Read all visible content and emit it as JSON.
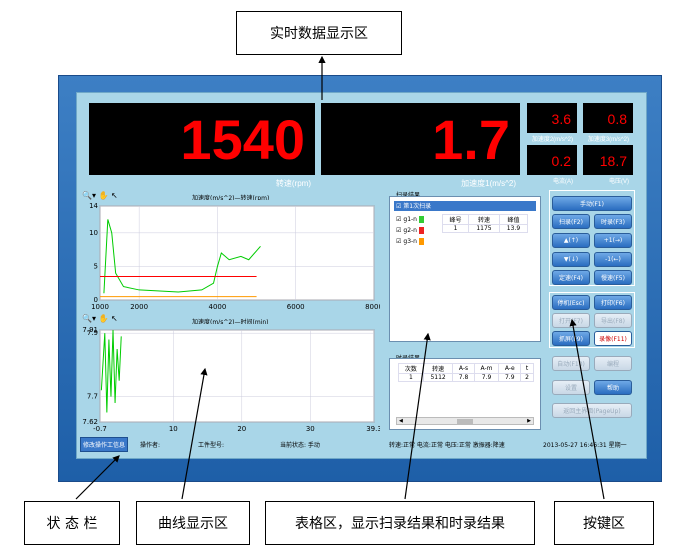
{
  "callouts": {
    "realtime": "实时数据显示区",
    "status": "状 态 栏",
    "curve": "曲线显示区",
    "table": "表格区，显示扫录结果和时录结果",
    "keys": "按键区"
  },
  "readouts": {
    "speed": {
      "value": "1540",
      "label": "转速(rpm)"
    },
    "accel1": {
      "value": "1.7",
      "label": "加速度1(m/s^2)"
    },
    "accel2": {
      "value": "3.6",
      "label": "加速度2(m/s^2)"
    },
    "accel3": {
      "value": "0.8",
      "label": "加速度3(m/s^2)"
    },
    "current": {
      "value": "0.2",
      "label": "电流(A)"
    },
    "voltage": {
      "value": "18.7",
      "label": "电压(V)"
    }
  },
  "chart1": {
    "title": "加速度(m/s^2)—转速(rpm)",
    "yticks": [
      "14",
      "10",
      "5",
      "0"
    ],
    "xticks": [
      "1000",
      "2000",
      "4000",
      "6000",
      "8000"
    ]
  },
  "chart2": {
    "title": "加速度(m/s^2)—时间(min)",
    "yticks": [
      "7.91",
      "7.9",
      "7.7",
      "7.62"
    ],
    "xticks": [
      "-0.7",
      "10",
      "20",
      "30",
      "39.3"
    ]
  },
  "chart_data": [
    {
      "type": "line",
      "title": "加速度(m/s^2)—转速(rpm)",
      "xlim": [
        1000,
        8000
      ],
      "ylim": [
        0,
        14
      ],
      "series": [
        {
          "color": "#00cc00",
          "x": [
            1100,
            1200,
            1300,
            1400,
            1600,
            2000,
            3000,
            3600,
            3900,
            4000,
            4100,
            4300,
            4600,
            4800,
            5100
          ],
          "y": [
            1,
            12,
            10,
            4,
            2,
            1.5,
            1.2,
            1.5,
            2.5,
            5,
            7,
            6,
            6.5,
            6,
            8
          ]
        },
        {
          "color": "#ff0000",
          "x": [
            1000,
            5000
          ],
          "y": [
            3.5,
            3.5
          ]
        },
        {
          "color": "#ff9900",
          "x": [
            1000,
            5000
          ],
          "y": [
            0.5,
            0.5
          ]
        }
      ]
    },
    {
      "type": "line",
      "title": "加速度(m/s^2)—时间(min)",
      "xlim": [
        -0.7,
        39.3
      ],
      "ylim": [
        7.62,
        7.91
      ],
      "series": [
        {
          "color": "#00cc00",
          "x": [
            -0.5,
            0,
            0.3,
            0.6,
            0.9,
            1.2,
            1.5,
            1.8,
            2.1,
            2.4
          ],
          "y": [
            7.72,
            7.9,
            7.65,
            7.88,
            7.7,
            7.91,
            7.68,
            7.85,
            7.75,
            7.89
          ]
        }
      ]
    }
  ],
  "scan": {
    "title": "扫录结果",
    "root": "第1次扫录",
    "channels": [
      {
        "label": "g1-n",
        "color": "#33cc33"
      },
      {
        "label": "g2-n",
        "color": "#ee2222"
      },
      {
        "label": "g3-n",
        "color": "#ff9900"
      }
    ],
    "headers": [
      "峰号",
      "转速",
      "峰值"
    ],
    "rows": [
      [
        "1",
        "1175",
        "13.9"
      ]
    ]
  },
  "timerec": {
    "title": "时录结果",
    "headers": [
      "次数",
      "转速",
      "A-s",
      "A-m",
      "A-e",
      "t"
    ],
    "rows": [
      [
        "1",
        "5112",
        "7.8",
        "7.9",
        "7.9",
        "2"
      ]
    ]
  },
  "buttons": {
    "manual": "手动(F1)",
    "scanrec": "扫录(F2)",
    "timerec": "时录(F3)",
    "up": "▲(↑)",
    "plus": "+1(→)",
    "down": "▼(↓)",
    "minus": "-1(←)",
    "fixspeed": "定速(F4)",
    "slow": "慢速(F5)",
    "stop": "停机(Esc)",
    "print": "打印(F6)",
    "open": "打开(F7)",
    "export": "导出(F8)",
    "capture": "抓屏(F9)",
    "record": "录像(F11)",
    "auto": "自动(F10)",
    "program": "编程",
    "settings": "设置",
    "help": "帮助",
    "back": "返回主界面(PageUp)"
  },
  "status": {
    "edit": "修改操作工信息",
    "operator": "操作者:",
    "part": "工件型号:",
    "state": "当前状态: 手动",
    "health": "转速:正常  电流:正常  电压:正常  激振器:降速",
    "time": "2013-05-27 16:46:31 星期一"
  }
}
